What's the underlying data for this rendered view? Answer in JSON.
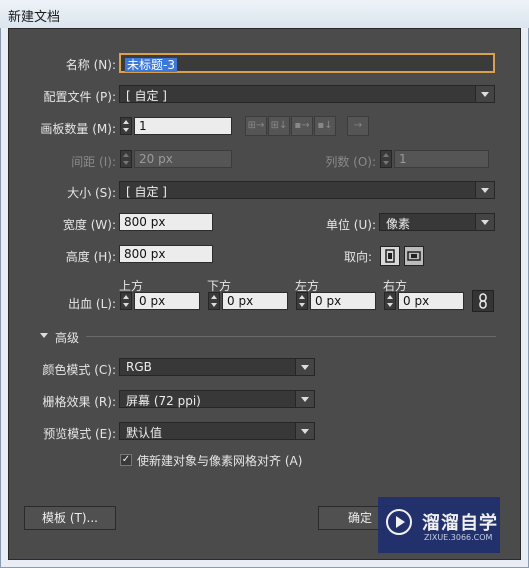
{
  "window": {
    "title": "新建文档"
  },
  "fields": {
    "name_label": "名称 (N):",
    "name_value": "未标题-3",
    "profile_label": "配置文件 (P):",
    "profile_value": "[ 自定 ]",
    "artboards_label": "画板数量 (M):",
    "artboards_value": "1",
    "spacing_label": "间距 (I):",
    "spacing_value": "20 px",
    "columns_label": "列数 (O):",
    "columns_value": "1",
    "size_label": "大小 (S):",
    "size_value": "[ 自定 ]",
    "width_label": "宽度 (W):",
    "width_value": "800 px",
    "units_label": "单位 (U):",
    "units_value": "像素",
    "height_label": "高度 (H):",
    "height_value": "800 px",
    "orientation_label": "取向:",
    "bleed_label": "出血 (L):",
    "bleed_top_label": "上方",
    "bleed_top_value": "0 px",
    "bleed_bottom_label": "下方",
    "bleed_bottom_value": "0 px",
    "bleed_left_label": "左方",
    "bleed_left_value": "0 px",
    "bleed_right_label": "右方",
    "bleed_right_value": "0 px"
  },
  "advanced": {
    "header": "高级",
    "color_mode_label": "颜色模式 (C):",
    "color_mode_value": "RGB",
    "raster_label": "栅格效果 (R):",
    "raster_value": "屏幕 (72 ppi)",
    "preview_label": "预览模式 (E):",
    "preview_value": "默认值",
    "align_pixel_label": "使新建对象与像素网格对齐 (A)",
    "align_pixel_checked": true
  },
  "buttons": {
    "templates": "模板 (T)...",
    "ok": "确定"
  },
  "watermark": {
    "title": "溜溜自学",
    "url": "ZIXUE.3066.COM"
  },
  "icons": [
    "artboard-grid-row-icon",
    "artboard-grid-col-icon",
    "artboard-row-icon",
    "artboard-col-icon",
    "arrow-right-icon",
    "portrait-icon",
    "landscape-icon",
    "link-icon",
    "chevron-down-icon",
    "play-icon"
  ]
}
